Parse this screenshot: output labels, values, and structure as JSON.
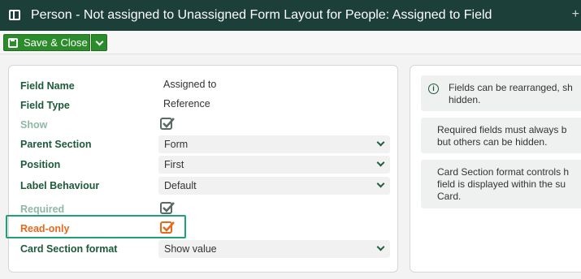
{
  "window": {
    "title": "Person - Not assigned to Unassigned Form Layout for People: Assigned to Field",
    "extra": "+"
  },
  "toolbar": {
    "save_close_label": "Save & Close"
  },
  "form": {
    "field_name": {
      "label": "Field Name",
      "value": "Assigned to"
    },
    "field_type": {
      "label": "Field Type",
      "value": "Reference"
    },
    "show": {
      "label": "Show",
      "checked": true
    },
    "parent_section": {
      "label": "Parent Section",
      "value": "Form"
    },
    "position": {
      "label": "Position",
      "value": "First"
    },
    "label_behaviour": {
      "label": "Label Behaviour",
      "value": "Default"
    },
    "required": {
      "label": "Required",
      "checked": true
    },
    "read_only": {
      "label": "Read-only",
      "checked": true
    },
    "card_section_format": {
      "label": "Card Section format",
      "value": "Show value"
    }
  },
  "hints": [
    {
      "line1": "Fields can be rearranged, sh",
      "line2": "hidden."
    },
    {
      "line1": "Required fields must always b",
      "line2": "but others can be hidden."
    },
    {
      "line1": "Card Section format controls h",
      "line2": "field is displayed within the su",
      "line3": "Card."
    }
  ],
  "colors": {
    "header": "#1d3f3a",
    "primary_button": "#2c8c2c",
    "label": "#1d5a3a",
    "highlight": "#e56a1c",
    "focus_outline": "#1fa07a"
  }
}
